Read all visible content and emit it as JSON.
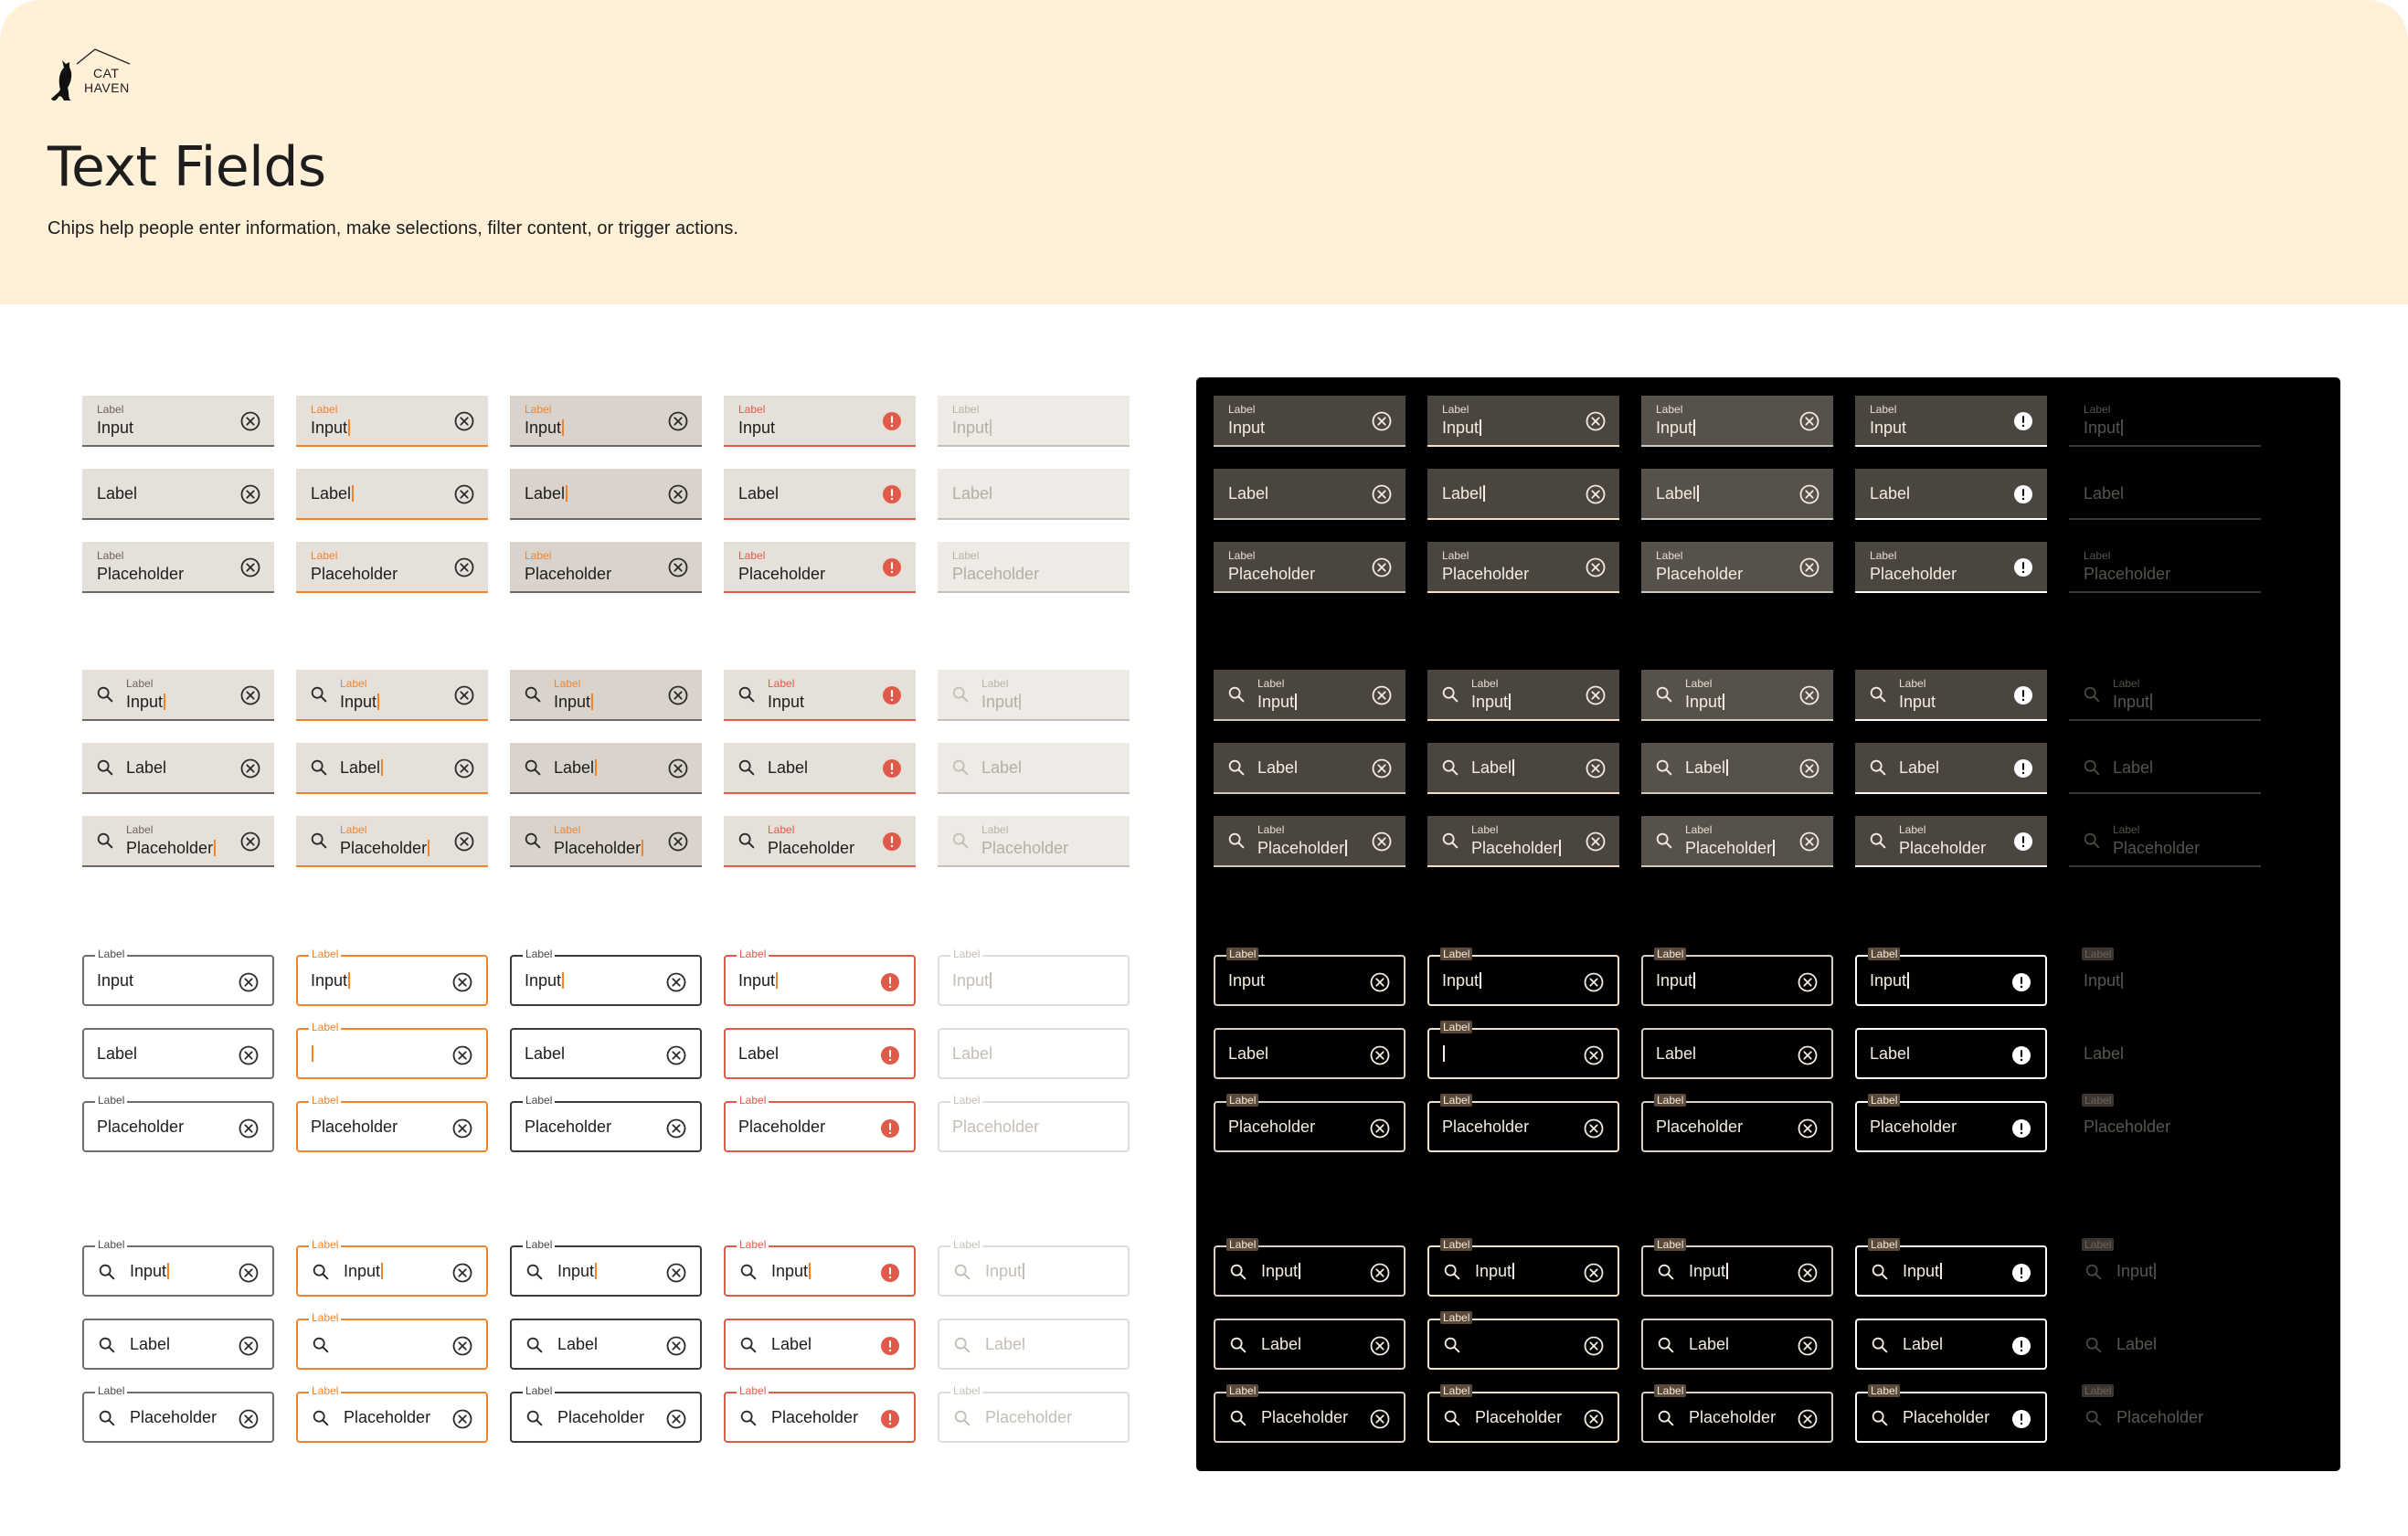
{
  "header": {
    "logo_line1": "CAT",
    "logo_line2": "HAVEN",
    "title": "Text Fields",
    "subtitle": "Chips help people enter information, make selections, filter content, or trigger actions."
  },
  "colors": {
    "header_bg": "#fff0d8",
    "accent": "#f0842c",
    "error": "#e05a4a",
    "dark_panel": "#000000",
    "filled_light": "#e5e0d9",
    "filled_dark": "#4a463f"
  },
  "states": [
    "enabled",
    "focused",
    "hovered",
    "error",
    "disabled"
  ],
  "icons": {
    "clear": "cancel-icon",
    "error": "error-icon",
    "search": "search-icon"
  },
  "groups": [
    {
      "variant": "filled",
      "search": false,
      "rows": [
        {
          "light": [
            {
              "label": "Label",
              "value": "Input",
              "caret": false
            },
            {
              "label": "Label",
              "value": "Input",
              "caret": true
            },
            {
              "label": "Label",
              "value": "Input",
              "caret": true
            },
            {
              "label": "Label",
              "value": "Input",
              "caret": false
            },
            {
              "label": "Label",
              "value": "Input",
              "caret": true
            }
          ],
          "dark": [
            {
              "label": "Label",
              "value": "Input",
              "caret": false
            },
            {
              "label": "Label",
              "value": "Input",
              "caret": true
            },
            {
              "label": "Label",
              "value": "Input",
              "caret": true
            },
            {
              "label": "Label",
              "value": "Input",
              "caret": false
            },
            {
              "label": "Label",
              "value": "Input",
              "caret": true
            }
          ]
        },
        {
          "light": [
            {
              "label": "",
              "value": "Label",
              "caret": false
            },
            {
              "label": "",
              "value": "Label",
              "caret": true
            },
            {
              "label": "",
              "value": "Label",
              "caret": true
            },
            {
              "label": "",
              "value": "Label",
              "caret": false
            },
            {
              "label": "",
              "value": "Label",
              "caret": false
            }
          ],
          "dark": [
            {
              "label": "",
              "value": "Label",
              "caret": false
            },
            {
              "label": "",
              "value": "Label",
              "caret": true
            },
            {
              "label": "",
              "value": "Label",
              "caret": true
            },
            {
              "label": "",
              "value": "Label",
              "caret": false
            },
            {
              "label": "",
              "value": "Label",
              "caret": false
            }
          ]
        },
        {
          "light": [
            {
              "label": "Label",
              "value": "Placeholder",
              "caret": false
            },
            {
              "label": "Label",
              "value": "Placeholder",
              "caret": false
            },
            {
              "label": "Label",
              "value": "Placeholder",
              "caret": false
            },
            {
              "label": "Label",
              "value": "Placeholder",
              "caret": false
            },
            {
              "label": "Label",
              "value": "Placeholder",
              "caret": false
            }
          ],
          "dark": [
            {
              "label": "Label",
              "value": "Placeholder",
              "caret": false
            },
            {
              "label": "Label",
              "value": "Placeholder",
              "caret": false
            },
            {
              "label": "Label",
              "value": "Placeholder",
              "caret": false
            },
            {
              "label": "Label",
              "value": "Placeholder",
              "caret": false
            },
            {
              "label": "Label",
              "value": "Placeholder",
              "caret": false
            }
          ]
        }
      ]
    },
    {
      "variant": "filled",
      "search": true,
      "rows": [
        {
          "light": [
            {
              "label": "Label",
              "value": "Input",
              "caret": true
            },
            {
              "label": "Label",
              "value": "Input",
              "caret": true
            },
            {
              "label": "Label",
              "value": "Input",
              "caret": true
            },
            {
              "label": "Label",
              "value": "Input",
              "caret": false
            },
            {
              "label": "Label",
              "value": "Input",
              "caret": true
            }
          ],
          "dark": [
            {
              "label": "Label",
              "value": "Input",
              "caret": true
            },
            {
              "label": "Label",
              "value": "Input",
              "caret": true
            },
            {
              "label": "Label",
              "value": "Input",
              "caret": true
            },
            {
              "label": "Label",
              "value": "Input",
              "caret": false
            },
            {
              "label": "Label",
              "value": "Input",
              "caret": true
            }
          ]
        },
        {
          "light": [
            {
              "label": "",
              "value": "Label",
              "caret": false
            },
            {
              "label": "",
              "value": "Label",
              "caret": true
            },
            {
              "label": "",
              "value": "Label",
              "caret": true
            },
            {
              "label": "",
              "value": "Label",
              "caret": false
            },
            {
              "label": "",
              "value": "Label",
              "caret": false
            }
          ],
          "dark": [
            {
              "label": "",
              "value": "Label",
              "caret": false
            },
            {
              "label": "",
              "value": "Label",
              "caret": true
            },
            {
              "label": "",
              "value": "Label",
              "caret": true
            },
            {
              "label": "",
              "value": "Label",
              "caret": false
            },
            {
              "label": "",
              "value": "Label",
              "caret": false
            }
          ]
        },
        {
          "light": [
            {
              "label": "Label",
              "value": "Placeholder",
              "caret": true
            },
            {
              "label": "Label",
              "value": "Placeholder",
              "caret": true
            },
            {
              "label": "Label",
              "value": "Placeholder",
              "caret": true
            },
            {
              "label": "Label",
              "value": "Placeholder",
              "caret": false
            },
            {
              "label": "Label",
              "value": "Placeholder",
              "caret": false
            }
          ],
          "dark": [
            {
              "label": "Label",
              "value": "Placeholder",
              "caret": true
            },
            {
              "label": "Label",
              "value": "Placeholder",
              "caret": true
            },
            {
              "label": "Label",
              "value": "Placeholder",
              "caret": true
            },
            {
              "label": "Label",
              "value": "Placeholder",
              "caret": false
            },
            {
              "label": "Label",
              "value": "Placeholder",
              "caret": false
            }
          ]
        }
      ]
    },
    {
      "variant": "outlined",
      "search": false,
      "rows": [
        {
          "light": [
            {
              "label": "Label",
              "value": "Input",
              "caret": false
            },
            {
              "label": "Label",
              "value": "Input",
              "caret": true
            },
            {
              "label": "Label",
              "value": "Input",
              "caret": true
            },
            {
              "label": "Label",
              "value": "Input",
              "caret": true
            },
            {
              "label": "Label",
              "value": "Input",
              "caret": true
            }
          ],
          "dark": [
            {
              "label": "Label",
              "value": "Input",
              "caret": false
            },
            {
              "label": "Label",
              "value": "Input",
              "caret": true
            },
            {
              "label": "Label",
              "value": "Input",
              "caret": true
            },
            {
              "label": "Label",
              "value": "Input",
              "caret": true
            },
            {
              "label": "Label",
              "value": "Input",
              "caret": true
            }
          ]
        },
        {
          "light": [
            {
              "label": "",
              "value": "Label",
              "caret": false
            },
            {
              "label": "Label",
              "value": "",
              "caret": true
            },
            {
              "label": "",
              "value": "Label",
              "caret": false
            },
            {
              "label": "",
              "value": "Label",
              "caret": false
            },
            {
              "label": "",
              "value": "Label",
              "caret": false
            }
          ],
          "dark": [
            {
              "label": "",
              "value": "Label",
              "caret": false
            },
            {
              "label": "Label",
              "value": "",
              "caret": true
            },
            {
              "label": "",
              "value": "Label",
              "caret": false
            },
            {
              "label": "",
              "value": "Label",
              "caret": false
            },
            {
              "label": "",
              "value": "Label",
              "caret": false
            }
          ]
        },
        {
          "light": [
            {
              "label": "Label",
              "value": "Placeholder",
              "caret": false
            },
            {
              "label": "Label",
              "value": "Placeholder",
              "caret": false
            },
            {
              "label": "Label",
              "value": "Placeholder",
              "caret": false
            },
            {
              "label": "Label",
              "value": "Placeholder",
              "caret": false
            },
            {
              "label": "Label",
              "value": "Placeholder",
              "caret": false
            }
          ],
          "dark": [
            {
              "label": "Label",
              "value": "Placeholder",
              "caret": false
            },
            {
              "label": "Label",
              "value": "Placeholder",
              "caret": false
            },
            {
              "label": "Label",
              "value": "Placeholder",
              "caret": false
            },
            {
              "label": "Label",
              "value": "Placeholder",
              "caret": false
            },
            {
              "label": "Label",
              "value": "Placeholder",
              "caret": false
            }
          ]
        }
      ]
    },
    {
      "variant": "outlined",
      "search": true,
      "rows": [
        {
          "light": [
            {
              "label": "Label",
              "value": "Input",
              "caret": true
            },
            {
              "label": "Label",
              "value": "Input",
              "caret": true
            },
            {
              "label": "Label",
              "value": "Input",
              "caret": true
            },
            {
              "label": "Label",
              "value": "Input",
              "caret": true
            },
            {
              "label": "Label",
              "value": "Input",
              "caret": true
            }
          ],
          "dark": [
            {
              "label": "Label",
              "value": "Input",
              "caret": true
            },
            {
              "label": "Label",
              "value": "Input",
              "caret": true
            },
            {
              "label": "Label",
              "value": "Input",
              "caret": true
            },
            {
              "label": "Label",
              "value": "Input",
              "caret": true
            },
            {
              "label": "Label",
              "value": "Input",
              "caret": true
            }
          ]
        },
        {
          "light": [
            {
              "label": "",
              "value": "Label",
              "caret": false
            },
            {
              "label": "Label",
              "value": "",
              "caret": false
            },
            {
              "label": "",
              "value": "Label",
              "caret": false
            },
            {
              "label": "",
              "value": "Label",
              "caret": false
            },
            {
              "label": "",
              "value": "Label",
              "caret": false
            }
          ],
          "dark": [
            {
              "label": "",
              "value": "Label",
              "caret": false
            },
            {
              "label": "Label",
              "value": "",
              "caret": false
            },
            {
              "label": "",
              "value": "Label",
              "caret": false
            },
            {
              "label": "",
              "value": "Label",
              "caret": false
            },
            {
              "label": "",
              "value": "Label",
              "caret": false
            }
          ]
        },
        {
          "light": [
            {
              "label": "Label",
              "value": "Placeholder",
              "caret": false
            },
            {
              "label": "Label",
              "value": "Placeholder",
              "caret": false
            },
            {
              "label": "Label",
              "value": "Placeholder",
              "caret": false
            },
            {
              "label": "Label",
              "value": "Placeholder",
              "caret": false
            },
            {
              "label": "Label",
              "value": "Placeholder",
              "caret": false
            }
          ],
          "dark": [
            {
              "label": "Label",
              "value": "Placeholder",
              "caret": false
            },
            {
              "label": "Label",
              "value": "Placeholder",
              "caret": false
            },
            {
              "label": "Label",
              "value": "Placeholder",
              "caret": false
            },
            {
              "label": "Label",
              "value": "Placeholder",
              "caret": false
            },
            {
              "label": "Label",
              "value": "Placeholder",
              "caret": false
            }
          ]
        }
      ]
    }
  ]
}
